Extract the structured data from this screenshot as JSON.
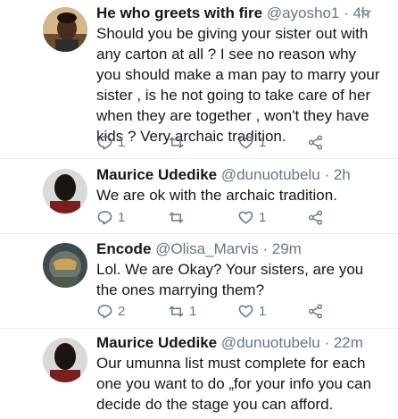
{
  "tweets": [
    {
      "name": "He who greets with fire",
      "handle": "@ayosho1",
      "time": "· 4h",
      "text": "Should you be giving your sister out with any carton at all ? I see no reason why you should make a man pay to marry your sister , is he not going to take care of her when they are together , won't they have kids ? Very archaic tradition.",
      "replies": "1",
      "retweets": "",
      "likes": "1"
    },
    {
      "name": "Maurice Udedike",
      "handle": "@dunuotubelu",
      "time": "· 2h",
      "text": "We are ok with the archaic tradition.",
      "replies": "1",
      "retweets": "",
      "likes": "1"
    },
    {
      "name": "Encode",
      "handle": "@Olisa_Marvis",
      "time": "· 29m",
      "text": "Lol. We are Okay? Your sisters, are you the ones marrying them?",
      "replies": "2",
      "retweets": "1",
      "likes": "1"
    },
    {
      "name": "Maurice Udedike",
      "handle": "@dunuotubelu",
      "time": "· 22m",
      "text": "Our umunna list must complete for each one you want to do „for your info you can decide do the stage you can afford.",
      "replies": "",
      "retweets": "",
      "likes": ""
    }
  ],
  "icons": {
    "reply": "reply-icon",
    "retweet": "retweet-icon",
    "like": "heart-icon",
    "share": "share-icon",
    "menu": "chevron-down-icon"
  },
  "colors": {
    "text": "#14171a",
    "muted": "#657786",
    "divider": "#e6ecf0"
  }
}
